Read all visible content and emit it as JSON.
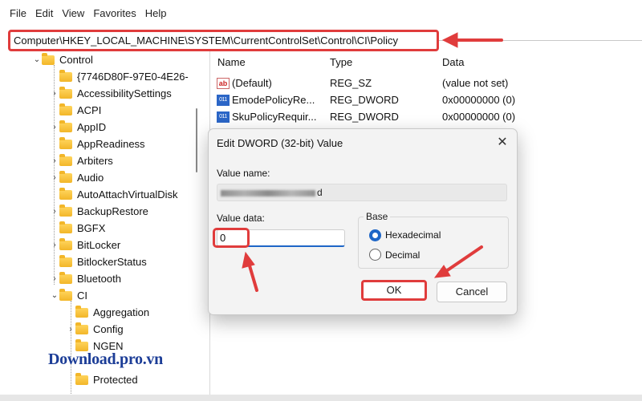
{
  "menu": [
    "File",
    "Edit",
    "View",
    "Favorites",
    "Help"
  ],
  "address": {
    "path": "Computer\\HKEY_LOCAL_MACHINE\\SYSTEM\\CurrentControlSet\\Control\\CI\\Policy"
  },
  "tree": {
    "items": [
      {
        "label": "Control",
        "expanded": true
      },
      {
        "label": "{7746D80F-97E0-4E26-"
      },
      {
        "label": "AccessibilitySettings"
      },
      {
        "label": "ACPI"
      },
      {
        "label": "AppID"
      },
      {
        "label": "AppReadiness"
      },
      {
        "label": "Arbiters"
      },
      {
        "label": "Audio"
      },
      {
        "label": "AutoAttachVirtualDisk"
      },
      {
        "label": "BackupRestore"
      },
      {
        "label": "BGFX"
      },
      {
        "label": "BitLocker"
      },
      {
        "label": "BitlockerStatus"
      },
      {
        "label": "Bluetooth"
      },
      {
        "label": "CI",
        "expanded": true
      },
      {
        "label": "Aggregation"
      },
      {
        "label": "Config"
      },
      {
        "label": "NGEN"
      },
      {
        "label": "Protected"
      }
    ]
  },
  "list": {
    "columns": [
      "Name",
      "Type",
      "Data"
    ],
    "rows": [
      {
        "name": "(Default)",
        "type": "REG_SZ",
        "data": "(value not set)",
        "icon": "string-value-icon"
      },
      {
        "name": "EmodePolicyRe...",
        "type": "REG_DWORD",
        "data": "0x00000000 (0)",
        "icon": "binary-value-icon"
      },
      {
        "name": "SkuPolicyRequir...",
        "type": "REG_DWORD",
        "data": "0x00000000 (0)",
        "icon": "binary-value-icon"
      }
    ]
  },
  "dialog": {
    "title": "Edit DWORD (32-bit) Value",
    "close_glyph": "✕",
    "value_name_label": "Value name:",
    "value_name_tail": "d",
    "value_data_label": "Value data:",
    "value_data": "0",
    "base_label": "Base",
    "radio_hex": "Hexadecimal",
    "radio_dec": "Decimal",
    "selected_base": "Hexadecimal",
    "ok_label": "OK",
    "cancel_label": "Cancel"
  },
  "icons": {
    "string": "ab",
    "binary": "011\n110"
  },
  "watermark": "Download.pro.vn",
  "colors": {
    "highlight": "#e03c3c",
    "accent": "#1e66c7",
    "folder": "#f2b629"
  }
}
